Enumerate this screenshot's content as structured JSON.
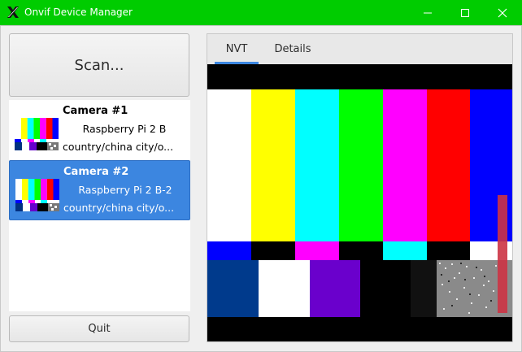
{
  "window": {
    "title": "Onvif Device Manager",
    "icon": "x-app-icon"
  },
  "left": {
    "scan_label": "Scan...",
    "quit_label": "Quit",
    "cameras": [
      {
        "name": "Camera #1",
        "model": "Raspberry Pi 2 B",
        "location": "country/china city/o...",
        "selected": false
      },
      {
        "name": "Camera #2",
        "model": "Raspberry Pi 2 B-2",
        "location": "country/china city/o...",
        "selected": true
      }
    ]
  },
  "tabs": [
    {
      "label": "NVT",
      "active": true
    },
    {
      "label": "Details",
      "active": false
    }
  ],
  "colors": {
    "titlebar": "#00cc00",
    "selection": "#3c86e0",
    "tab_indicator": "#3c86e0"
  }
}
